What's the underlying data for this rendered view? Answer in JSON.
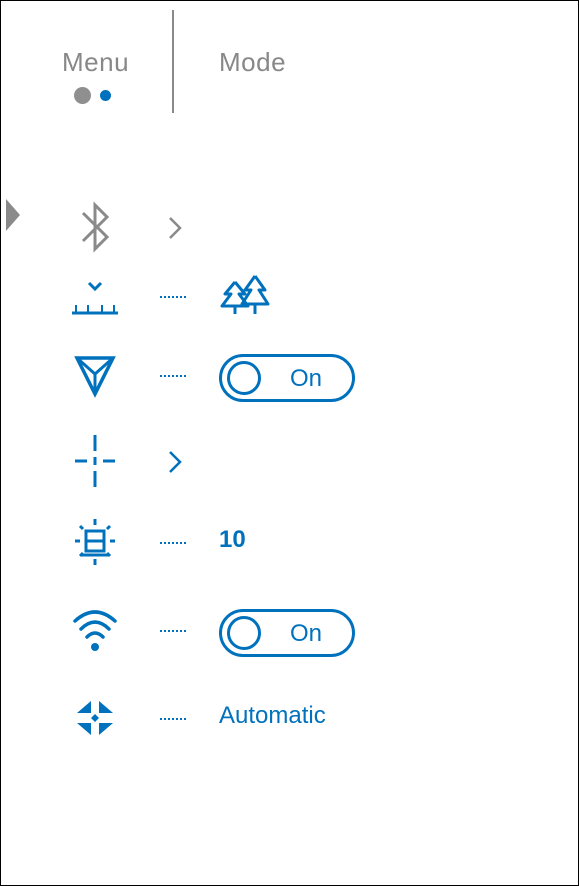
{
  "header": {
    "tabs": [
      {
        "label": "Menu"
      },
      {
        "label": "Mode"
      }
    ]
  },
  "settings": [
    {
      "icon": "bluetooth-icon",
      "type": "submenu"
    },
    {
      "icon": "calibration-icon",
      "type": "value",
      "value_icon": "forest-icon"
    },
    {
      "icon": "filter-icon",
      "type": "toggle",
      "value": "On"
    },
    {
      "icon": "crosshair-icon",
      "type": "submenu"
    },
    {
      "icon": "brightness-icon",
      "type": "value",
      "value": "10"
    },
    {
      "icon": "wifi-icon",
      "type": "toggle",
      "value": "On"
    },
    {
      "icon": "mode-arrows-icon",
      "type": "value",
      "value": "Automatic"
    }
  ],
  "colors": {
    "accent": "#0071bc",
    "inactive": "#8a8a8a",
    "background": "#ffffff"
  }
}
